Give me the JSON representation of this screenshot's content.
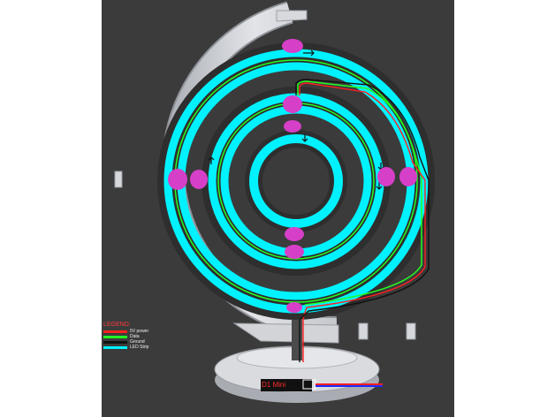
{
  "legend": {
    "title": "LEGEND:",
    "items": [
      {
        "label": "5V power",
        "color": "#ff1f1f"
      },
      {
        "label": "Data",
        "color": "#22ff22"
      },
      {
        "label": "Ground",
        "color": "#111111"
      },
      {
        "label": "LED Strip",
        "color": "#00f2ff"
      }
    ]
  },
  "board": {
    "label": "D1 Mini"
  },
  "colors": {
    "background": "#3b3b3b",
    "frame": "#cdd0d6",
    "led_strip": "#00f2ff",
    "connector": "#d63fc7",
    "power": "#ff1f1f",
    "data": "#22ff22",
    "ground": "#111111",
    "usb": "#1b2cff"
  }
}
